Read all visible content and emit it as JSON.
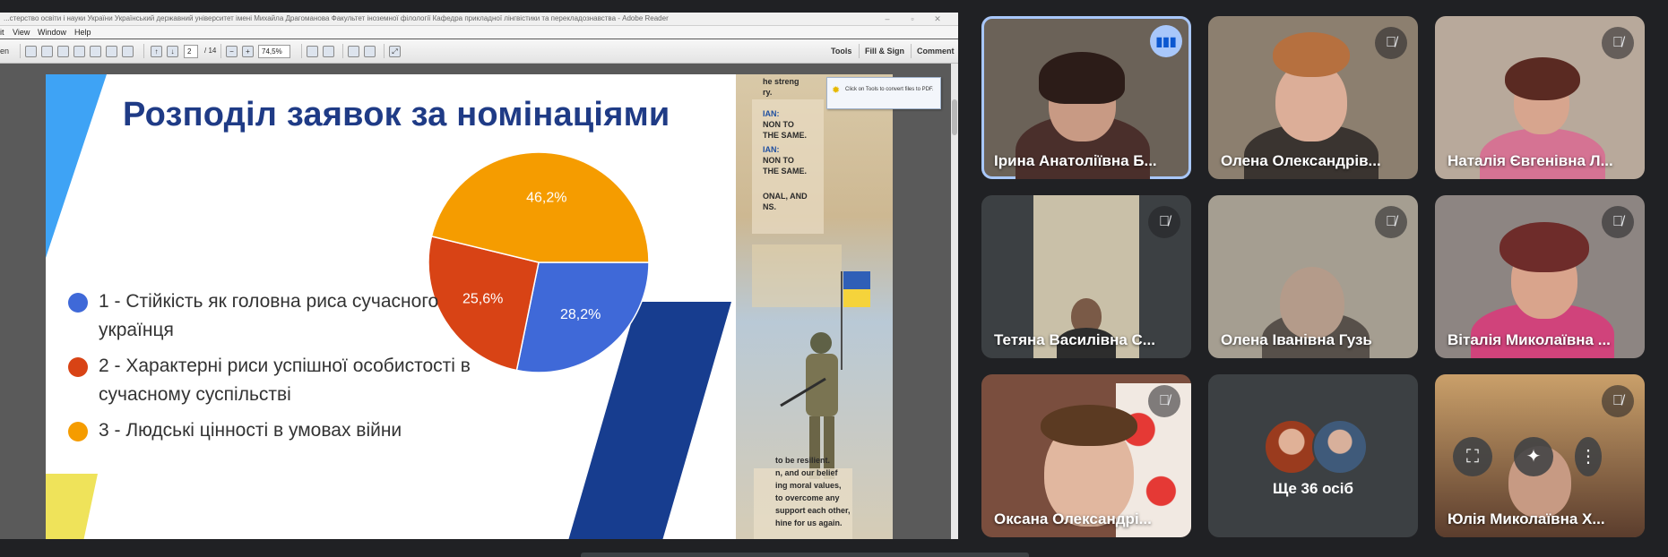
{
  "reader": {
    "title": "...стерство освіти і науки України Український державний університет імені Михайла Драгоманова Факультет іноземної філології Кафедра прикладної лінгвістики та перекладознавства - Adobe Reader",
    "menu": [
      "it",
      "View",
      "Window",
      "Help"
    ],
    "toolbar": {
      "open_label": "en",
      "page_current": "2",
      "page_total": "/ 14",
      "zoom": "74,5%",
      "tools_label": "Tools",
      "fill_sign_label": "Fill & Sign",
      "comment_label": "Comment"
    },
    "tooltip": "Click on Tools to convert files to PDF."
  },
  "slide": {
    "title": "Розподіл заявок за номінаціями",
    "legend": [
      {
        "text": "1 - Стійкість як головна риса сучасного українця",
        "color": "#3f69d8"
      },
      {
        "text": "2 - Характерні риси успішної особистості в сучасному суспільстві",
        "color": "#d84315"
      },
      {
        "text": "3 - Людські цінності в умовах війни",
        "color": "#f59c00"
      }
    ],
    "poster": {
      "line1": "he streng",
      "line2": "ry.",
      "line3": "IAN:",
      "line4": "NON TO",
      "line5": "THE SAME.",
      "line6": "IAN:",
      "line7": "NON TO",
      "line8": "THE SAME.",
      "line9": "ONAL, AND",
      "line10": "NS.",
      "bottom1": "to be resilient.",
      "bottom2": "n, and our belief",
      "bottom3": "ing moral values,",
      "bottom4": "to overcome any",
      "bottom5": "support each other,",
      "bottom6": "hine for us again."
    }
  },
  "chart_data": {
    "type": "pie",
    "labels": [
      "1",
      "2",
      "3"
    ],
    "values": [
      28.2,
      25.6,
      46.2
    ],
    "value_labels": [
      "28,2%",
      "25,6%",
      "46,2%"
    ],
    "colors": [
      "#3f69d8",
      "#d84315",
      "#f59c00"
    ],
    "title": ""
  },
  "participants": [
    {
      "name": "Ірина Анатоліївна Б...",
      "speaking": true
    },
    {
      "name": "Олена Олександрів...",
      "speaking": false
    },
    {
      "name": "Наталія Євгенівна Л...",
      "speaking": false
    },
    {
      "name": "Тетяна Василівна С...",
      "speaking": false
    },
    {
      "name": "Олена Іванівна Гузь",
      "speaking": false
    },
    {
      "name": "Віталія Миколаївна ...",
      "speaking": false
    },
    {
      "name": "Оксана Олександрі...",
      "speaking": false
    },
    {
      "name": "Юлія Миколаївна Х...",
      "speaking": false
    }
  ],
  "more_tile": {
    "label": "Ще 36 осіб"
  },
  "icons": {
    "mic_off": "mic-off-icon",
    "speaking": "audio-level-icon"
  }
}
